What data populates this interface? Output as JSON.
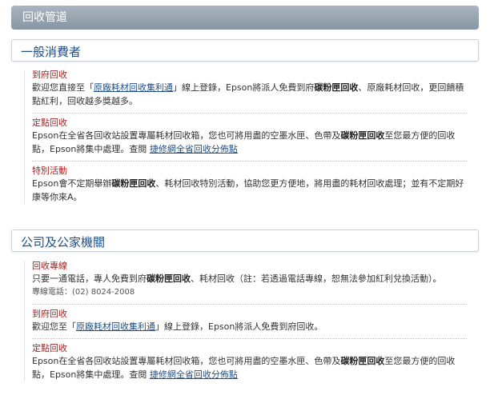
{
  "header": {
    "title": "回收管道"
  },
  "section1": {
    "title": "一般消費者",
    "items": [
      {
        "title": "到府回收",
        "pre": "歡迎您直接至「",
        "link": "原廠耗材回收集利通",
        "mid": "」線上登錄，Epson將派人免費到府",
        "bold": "碳粉匣回收",
        "post": "、原廠耗材回收，更回饋積點紅利，回收越多獎越多。"
      },
      {
        "title": "定點回收",
        "pre": "Epson在全省各回收站設置專屬耗材回收箱，您也可將用盡的空墨水匣、色帶及",
        "bold": "碳粉匣回收",
        "mid": "至您最方便的回收點，Epson將集中處理。查閱 ",
        "link": "捷修網全省回收分佈點"
      },
      {
        "title": "特別活動",
        "pre": "Epson會不定期舉辦",
        "bold": "碳粉匣回收",
        "post": "、耗材回收特別活動，協助您更方便地，將用盡的耗材回收處理；並有不定期好康等你來A。"
      }
    ]
  },
  "section2": {
    "title": "公司及公家機關",
    "items": [
      {
        "title": "回收專線",
        "pre": "只要一通電話，專人免費到府",
        "bold": "碳粉匣回收",
        "post": "、耗材回收（註：若透過電話專線，恕無法參加紅利兌換活動）。",
        "phone": "專線電話：(02) 8024-2008"
      },
      {
        "title": "到府回收",
        "pre": "歡迎您至「",
        "link": "原廠耗材回收集利通",
        "post": "」線上登錄，Epson將派人免費到府回收。"
      },
      {
        "title": "定點回收",
        "pre": "Epson在全省各回收站設置專屬耗材回收箱，您也可將用盡的空墨水匣、色帶及",
        "bold": "碳粉匣回收",
        "mid": "至您最方便的回收點，Epson將集中處理。查閱 ",
        "link": "捷修網全省回收分佈點"
      }
    ]
  }
}
